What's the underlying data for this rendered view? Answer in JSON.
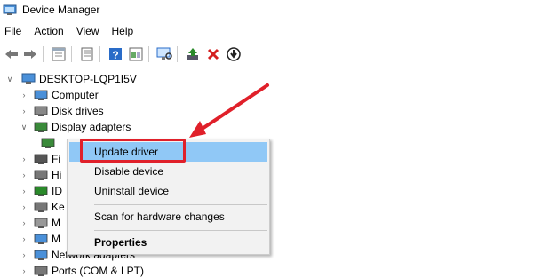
{
  "window": {
    "title": "Device Manager"
  },
  "menubar": [
    "File",
    "Action",
    "View",
    "Help"
  ],
  "toolbar": {
    "icons": [
      "back-arrow-icon",
      "forward-arrow-icon",
      "properties-icon",
      "list-icon",
      "help-icon",
      "panel-icon",
      "monitor-scan-icon",
      "update-driver-icon",
      "uninstall-x-icon",
      "download-icon"
    ],
    "colors": {
      "green": "#2a8a2a",
      "red": "#d42020",
      "blue": "#2a6cc8"
    }
  },
  "tree": {
    "root": "DESKTOP-LQP1I5V",
    "items": [
      {
        "label": "Computer",
        "icon": "computer-icon"
      },
      {
        "label": "Disk drives",
        "icon": "disk-icon"
      },
      {
        "label": "Display adapters",
        "icon": "display-adapter-icon",
        "expanded": true
      },
      {
        "label": "",
        "icon": "display-adapter-icon",
        "child": true
      },
      {
        "label": "Fi",
        "icon": "firmware-icon"
      },
      {
        "label": "Hi",
        "icon": "hid-icon"
      },
      {
        "label": "ID",
        "icon": "ide-icon"
      },
      {
        "label": "Ke",
        "icon": "keyboard-icon"
      },
      {
        "label": "M",
        "icon": "mouse-icon"
      },
      {
        "label": "M",
        "icon": "monitor-icon"
      },
      {
        "label": "Network adapters",
        "icon": "network-icon"
      },
      {
        "label": "Ports (COM & LPT)",
        "icon": "port-icon"
      }
    ],
    "child_suffix": "5"
  },
  "context_menu": {
    "items": [
      "Update driver",
      "Disable device",
      "Uninstall device",
      "Scan for hardware changes",
      "Properties"
    ],
    "highlighted": 0,
    "highlight_color": "#90c8f6",
    "annotation_color": "#e0202a"
  }
}
